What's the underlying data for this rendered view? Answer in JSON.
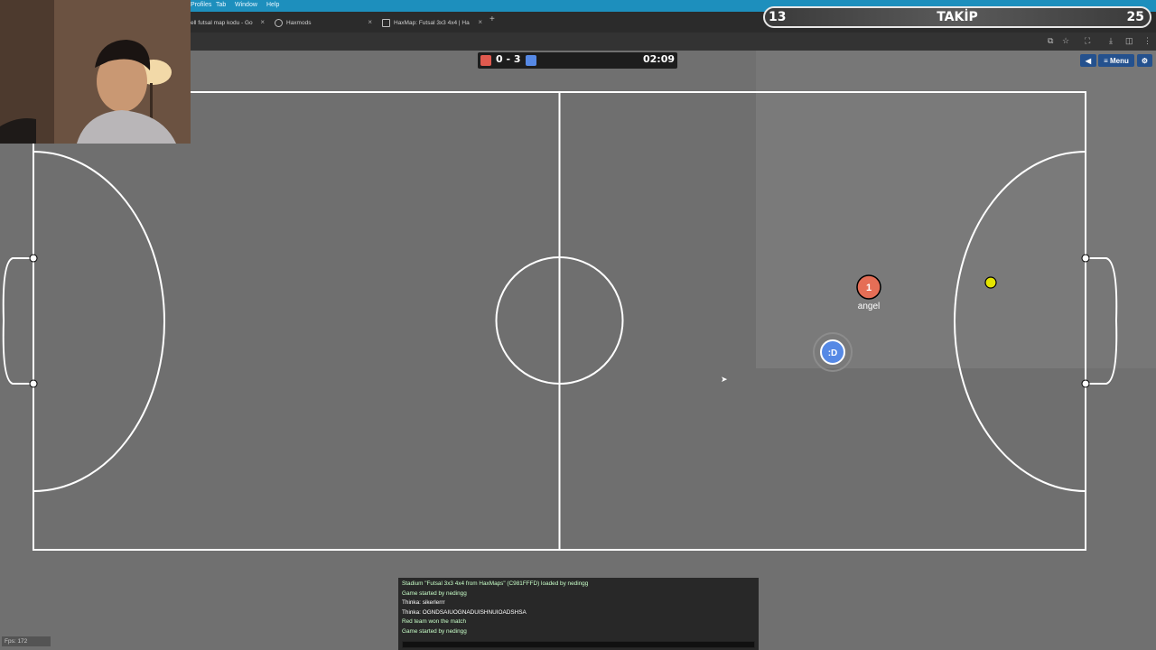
{
  "menubar": {
    "items": [
      "Profiles",
      "Tab",
      "Window",
      "Help"
    ]
  },
  "browser": {
    "tabs": [
      {
        "label": "ell futsal map kodu - Go"
      },
      {
        "label": "Haxmods"
      },
      {
        "label": "HaxMap: Futsal 3x3 4x4 | Ha"
      }
    ],
    "new_tab": "+"
  },
  "follow_overlay": {
    "left_count": "13",
    "label": "TAKİP",
    "right_count": "25"
  },
  "scoreboard": {
    "red_score": "0",
    "separator": "-",
    "blue_score": "3",
    "timer": "02:09",
    "red_color": "#e05a4f",
    "blue_color": "#5689e5"
  },
  "controls": {
    "sound_icon": "speaker-icon",
    "menu_label": "≡ Menu",
    "settings_icon": "gear-icon"
  },
  "players": [
    {
      "team": "red",
      "avatar": "1",
      "name": "angel",
      "color": "#e56e56"
    },
    {
      "team": "blue",
      "avatar": ":D",
      "name": "",
      "color": "#5689e5"
    }
  ],
  "ball": {
    "color": "#e5e500"
  },
  "chat": {
    "lines": [
      "Stadium \"Futsal 3x3 4x4 from HaxMaps\" (C981FFFD) loaded by nedingg",
      "Game started by nedingg",
      "Thinka: sikerlerrr",
      "Thinka: OGNDSAIUOGNADUISHNUIOADSHSA",
      "Red team won the match",
      "Game started by nedingg"
    ]
  },
  "fps": "Fps: 172"
}
